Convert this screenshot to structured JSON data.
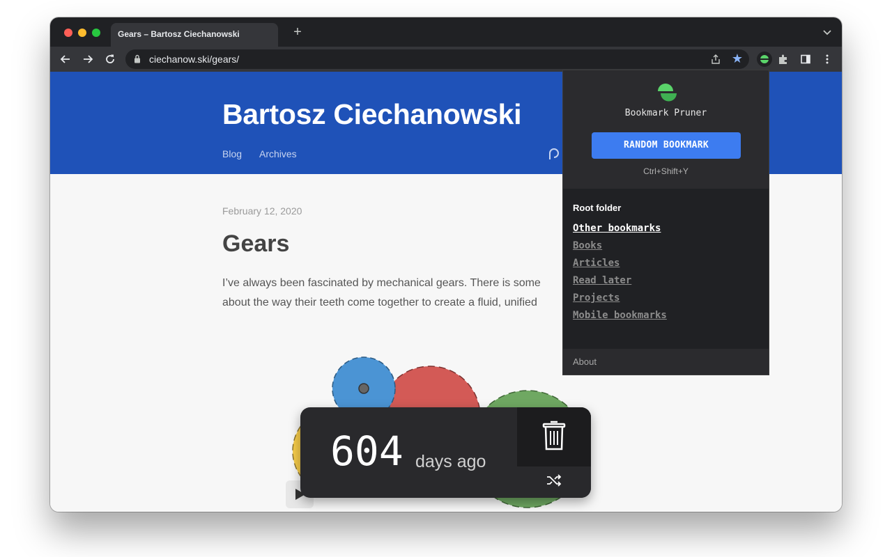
{
  "browser": {
    "tab_title": "Gears – Bartosz Ciechanowski",
    "new_tab_symbol": "+",
    "url": "ciechanow.ski/gears/"
  },
  "site": {
    "title": "Bartosz Ciechanowski",
    "nav": [
      "Blog",
      "Archives"
    ]
  },
  "post": {
    "date": "February 12, 2020",
    "title": "Gears",
    "body_line_1": "I’ve always been fascinated by mechanical gears. There is some",
    "body_line_2": "about the way their teeth come together to create a fluid, unified"
  },
  "extension": {
    "name": "Bookmark Pruner",
    "random_button": "RANDOM BOOKMARK",
    "shortcut": "Ctrl+Shift+Y",
    "root_label": "Root folder",
    "folders": [
      {
        "label": "Other bookmarks",
        "active": true
      },
      {
        "label": "Books",
        "active": false
      },
      {
        "label": "Articles",
        "active": false
      },
      {
        "label": "Read later",
        "active": false
      },
      {
        "label": "Projects",
        "active": false
      },
      {
        "label": "Mobile bookmarks",
        "active": false
      }
    ],
    "about": "About"
  },
  "age_card": {
    "number": "604",
    "unit": "days ago"
  },
  "colors": {
    "hero_blue": "#1f52b8",
    "button_blue": "#3d7cf0",
    "star_blue": "#8ab4f8",
    "logo_green": "#5ad46a"
  }
}
